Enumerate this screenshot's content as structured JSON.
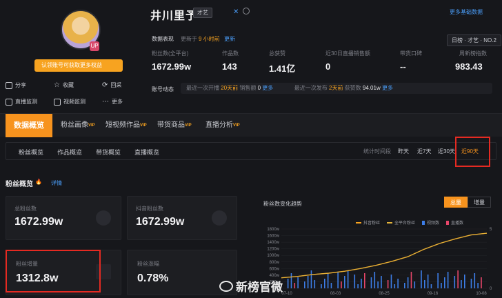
{
  "profile": {
    "name": "井川里予",
    "tag": "才艺",
    "avatar_badge": "UP",
    "follow_banner": "认领账号可获取更多权益",
    "more_link": "更多基础数据",
    "quick_actions": [
      {
        "label": "分享",
        "icon": "share-icon"
      },
      {
        "label": "收藏",
        "icon": "star-icon"
      },
      {
        "label": "回采",
        "icon": "refresh-icon"
      },
      {
        "label": "直播监测",
        "icon": "live-icon"
      },
      {
        "label": "视频监测",
        "icon": "video-icon"
      },
      {
        "label": "更多",
        "icon": "more-icon"
      }
    ]
  },
  "data_perf": {
    "label": "数据表现",
    "updated_prefix": "更新于",
    "updated_value": "9 小时前",
    "update_link": "更新",
    "rank_chip": "日榜 · 才艺 · NO.2",
    "stats": [
      {
        "label": "粉丝数(全平台)",
        "value": "1672.99w"
      },
      {
        "label": "作品数",
        "value": "143"
      },
      {
        "label": "总获赞",
        "value": "1.41亿"
      },
      {
        "label": "近30日直播销售额",
        "value": "0"
      },
      {
        "label": "带货口碑",
        "value": "--"
      },
      {
        "label": "周新榜指数",
        "value": "983.43"
      }
    ]
  },
  "account_dyn": {
    "label": "账号动态",
    "live": {
      "prefix": "最近一次开播",
      "when": "20天前",
      "sales_label": "销售额",
      "sales": "0",
      "more": "更多"
    },
    "post": {
      "prefix": "最近一次发布",
      "when": "2天前",
      "likes_label": "获赞数",
      "likes": "94.01w",
      "more": "更多"
    }
  },
  "main_tabs": [
    {
      "label": "数据概览",
      "vip": ""
    },
    {
      "label": "粉丝画像",
      "vip": "VIP"
    },
    {
      "label": "短视频作品",
      "vip": "VIP"
    },
    {
      "label": "带货商品",
      "vip": "VIP"
    },
    {
      "label": "直播分析",
      "vip": "VIP"
    }
  ],
  "sub_tabs": [
    "粉丝概览",
    "作品概览",
    "带货概览",
    "直播概览"
  ],
  "time_filter": {
    "label": "统计时间段",
    "options": [
      "昨天",
      "近7天",
      "近30天",
      "近90天"
    ]
  },
  "fans": {
    "title": "粉丝概览",
    "detail_link": "详情",
    "cards": [
      {
        "label": "总粉丝数",
        "value": "1672.99w"
      },
      {
        "label": "抖音粉丝数",
        "value": "1672.99w"
      },
      {
        "label": "粉丝增量",
        "value": "1312.8w"
      },
      {
        "label": "粉丝涨幅",
        "value": "0.78%"
      }
    ]
  },
  "chart_toggle": [
    "总量",
    "增量"
  ],
  "chart_data": {
    "type": "line",
    "title": "粉丝数变化趋势",
    "x": [
      "07-10",
      "08-03",
      "08-25",
      "09-16",
      "10-08"
    ],
    "y_ticks": [
      "0w",
      "200w",
      "400w",
      "600w",
      "800w",
      "1000w",
      "1200w",
      "1400w",
      "1600w",
      "1800w"
    ],
    "right_ticks": [
      "0",
      "5"
    ],
    "ylim": [
      0,
      1800
    ],
    "series": [
      {
        "name": "抖音粉丝",
        "color": "#f7a320",
        "values": [
          320,
          360,
          420,
          460,
          520,
          600,
          700,
          820,
          960,
          1180,
          1360,
          1500,
          1620,
          1673
        ]
      },
      {
        "name": "全平台粉丝",
        "color": "#e2b23a",
        "values": [
          320,
          360,
          420,
          460,
          520,
          600,
          700,
          820,
          960,
          1180,
          1360,
          1500,
          1620,
          1673
        ]
      }
    ],
    "bars": [
      {
        "name": "视频数",
        "color": "#3d7ee8"
      },
      {
        "name": "直播数",
        "color": "#e8466a"
      }
    ]
  },
  "watermark": "新榜官微",
  "colors": {
    "accent": "#f7931e",
    "link": "#4a9df8",
    "highlight": "#e52a22"
  }
}
